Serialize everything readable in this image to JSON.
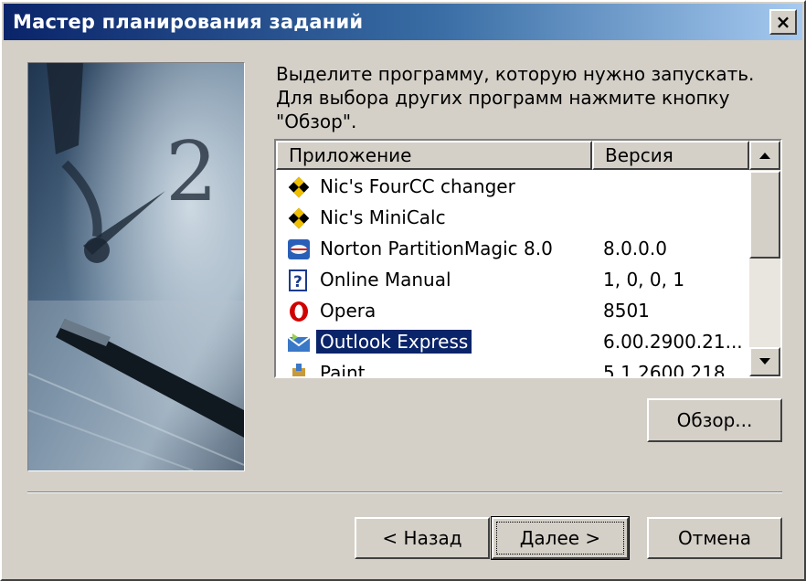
{
  "window": {
    "title": "Мастер планирования заданий",
    "close_label": "×"
  },
  "instruction": {
    "line1": "Выделите программу, которую нужно запускать.",
    "line2": "Для выбора других программ нажмите кнопку",
    "line3": "\"Обзор\"."
  },
  "listview": {
    "columns": {
      "application": "Приложение",
      "version": "Версия"
    },
    "rows": [
      {
        "name": "Nic's FourCC changer",
        "version": "",
        "icon": "checkered-diamond-icon"
      },
      {
        "name": "Nic's MiniCalc",
        "version": "",
        "icon": "checkered-diamond-icon"
      },
      {
        "name": "Norton PartitionMagic 8.0",
        "version": "8.0.0.0",
        "icon": "partition-magic-icon"
      },
      {
        "name": "Online Manual",
        "version": "1, 0, 0, 1",
        "icon": "help-document-icon"
      },
      {
        "name": "Opera",
        "version": "8501",
        "icon": "opera-icon"
      },
      {
        "name": "Outlook Express",
        "version": "6.00.2900.21...",
        "icon": "outlook-express-icon",
        "selected": true
      },
      {
        "name": "Paint",
        "version": "5.1.2600.218",
        "icon": "paint-icon"
      }
    ]
  },
  "buttons": {
    "browse": "Обзор...",
    "back": "< Назад",
    "next": "Далее >",
    "cancel": "Отмена"
  },
  "colors": {
    "titlebar_start": "#0a246a",
    "titlebar_end": "#a6caf0",
    "face": "#d4d0c8",
    "selection": "#0a246a"
  }
}
